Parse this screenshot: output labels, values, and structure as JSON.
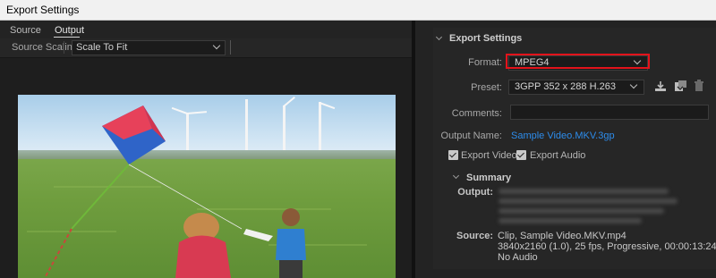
{
  "window": {
    "title": "Export Settings"
  },
  "left_panel": {
    "tabs": [
      {
        "label": "Source"
      },
      {
        "label": "Output"
      }
    ],
    "source_scaling": {
      "label": "Source Scaling:",
      "value": "Scale To Fit"
    }
  },
  "export_settings": {
    "section_title": "Export Settings",
    "format": {
      "label": "Format:",
      "value": "MPEG4"
    },
    "preset": {
      "label": "Preset:",
      "value": "3GPP 352 x 288 H.263"
    },
    "comments": {
      "label": "Comments:",
      "value": ""
    },
    "output_name": {
      "label": "Output Name:",
      "value": "Sample Video.MKV.3gp"
    },
    "export_video": {
      "label": "Export Video",
      "checked": true
    },
    "export_audio": {
      "label": "Export Audio",
      "checked": true
    },
    "preset_icons": [
      "download-preset-icon",
      "import-preset-icon",
      "trash-icon"
    ]
  },
  "summary": {
    "title": "Summary",
    "output_label": "Output:",
    "source_label": "Source:",
    "source_lines": [
      "Clip, Sample Video.MKV.mp4",
      "3840x2160 (1.0), 25 fps, Progressive, 00:00:13:24",
      "No Audio"
    ]
  },
  "colors": {
    "link": "#2d8ceb",
    "highlight": "#e3131b"
  }
}
